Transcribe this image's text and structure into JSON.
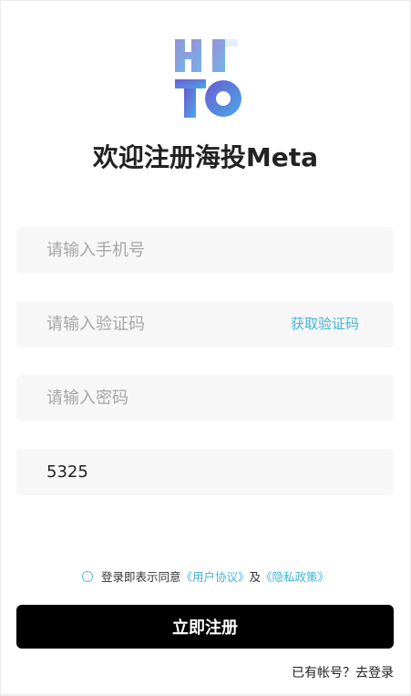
{
  "logo": {
    "line1": "HI",
    "line2": "TO"
  },
  "title": "欢迎注册海投Meta",
  "form": {
    "phone_placeholder": "请输入手机号",
    "code_placeholder": "请输入验证码",
    "get_code_label": "获取验证码",
    "password_placeholder": "请输入密码",
    "captcha_value": "5325"
  },
  "agreement": {
    "prefix": "登录即表示同意",
    "user_agreement": "《用户协议》",
    "and": "及",
    "privacy_policy": "《隐私政策》"
  },
  "register_button": "立即注册",
  "footer": {
    "prompt": "已有帐号？",
    "login_link": "去登录"
  },
  "colors": {
    "accent": "#3fb6d8",
    "button": "#000000",
    "field_bg": "#f7f7f7"
  }
}
